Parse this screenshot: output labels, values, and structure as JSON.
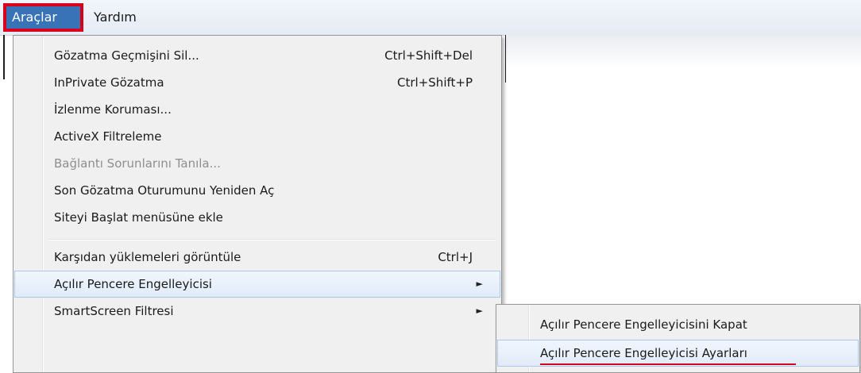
{
  "menubar": {
    "items": [
      {
        "label": "Araçlar",
        "active": true
      },
      {
        "label": "Yardım",
        "active": false
      }
    ]
  },
  "tools_menu": {
    "items": [
      {
        "label": "Gözatma Geçmişini Sil...",
        "shortcut": "Ctrl+Shift+Del"
      },
      {
        "label": "InPrivate Gözatma",
        "shortcut": "Ctrl+Shift+P"
      },
      {
        "label": "İzlenme Koruması..."
      },
      {
        "label": "ActiveX Filtreleme"
      },
      {
        "label": "Bağlantı Sorunlarını Tanıla...",
        "disabled": true
      },
      {
        "label": "Son Gözatma Oturumunu Yeniden Aç"
      },
      {
        "label": "Siteyi Başlat menüsüne ekle"
      },
      {
        "label": "Karşıdan yüklemeleri görüntüle",
        "shortcut": "Ctrl+J"
      },
      {
        "label": "Açılır Pencere Engelleyicisi",
        "submenu_arrow": "►",
        "highlighted": true
      },
      {
        "label": "SmartScreen Filtresi",
        "submenu_arrow": "►"
      }
    ]
  },
  "popup_submenu": {
    "items": [
      {
        "label": "Açılır Pencere Engelleyicisini Kapat"
      },
      {
        "label": "Açılır Pencere Engelleyicisi Ayarları",
        "highlighted": true
      }
    ]
  },
  "colors": {
    "active_menu_bg": "#3873b8",
    "annotation_red": "#d8001d",
    "menu_bg": "#f0f0f0",
    "highlight_border": "#a8c8f0"
  }
}
